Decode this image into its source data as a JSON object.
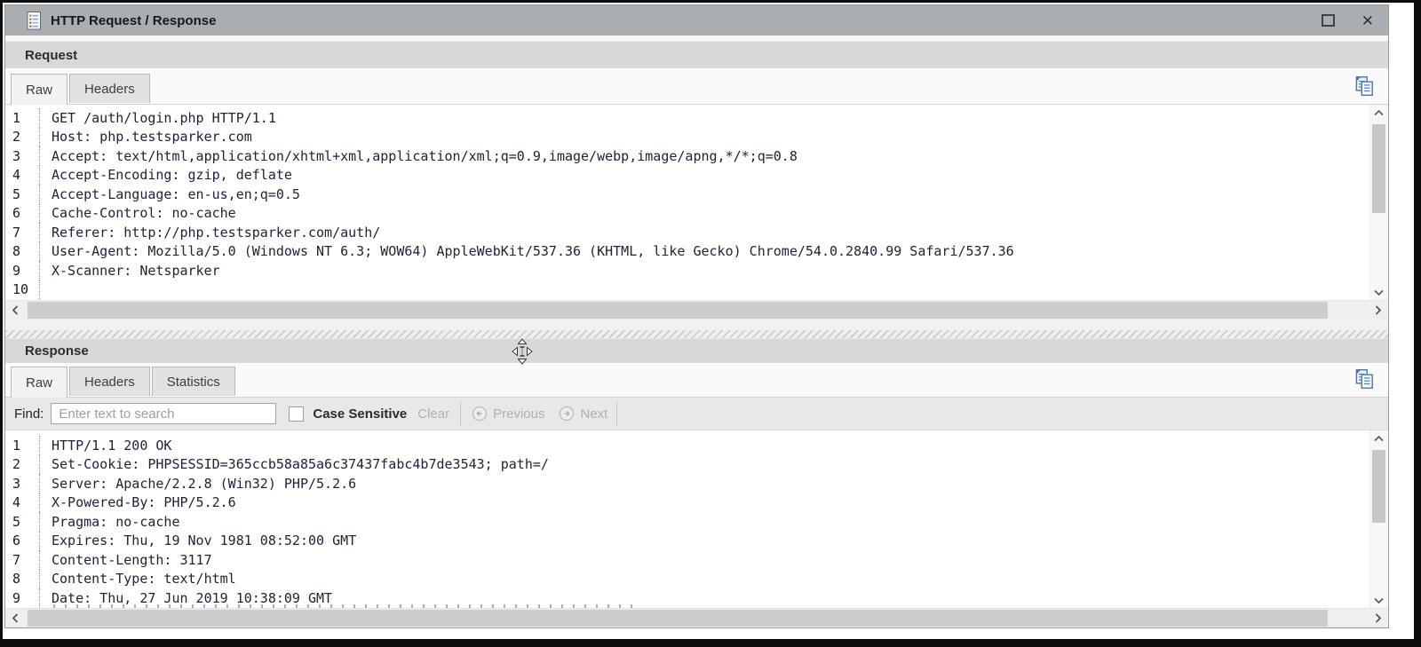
{
  "window": {
    "title": "HTTP Request / Response",
    "controls": {
      "maximize": "maximize",
      "close": "✕"
    }
  },
  "request": {
    "label": "Request",
    "tabs": [
      {
        "label": "Raw",
        "active": true
      },
      {
        "label": "Headers",
        "active": false
      }
    ],
    "lines": [
      {
        "num": "1",
        "text": "GET /auth/login.php HTTP/1.1"
      },
      {
        "num": "2",
        "text": "Host: php.testsparker.com"
      },
      {
        "num": "3",
        "text": "Accept: text/html,application/xhtml+xml,application/xml;q=0.9,image/webp,image/apng,*/*;q=0.8"
      },
      {
        "num": "4",
        "text": "Accept-Encoding: gzip, deflate"
      },
      {
        "num": "5",
        "text": "Accept-Language: en-us,en;q=0.5"
      },
      {
        "num": "6",
        "text": "Cache-Control: no-cache"
      },
      {
        "num": "7",
        "text": "Referer: http://php.testsparker.com/auth/"
      },
      {
        "num": "8",
        "text": "User-Agent: Mozilla/5.0 (Windows NT 6.3; WOW64) AppleWebKit/537.36 (KHTML, like Gecko) Chrome/54.0.2840.99 Safari/537.36"
      },
      {
        "num": "9",
        "text": "X-Scanner: Netsparker"
      },
      {
        "num": "10",
        "text": ""
      }
    ]
  },
  "response": {
    "label": "Response",
    "tabs": [
      {
        "label": "Raw",
        "active": true
      },
      {
        "label": "Headers",
        "active": false
      },
      {
        "label": "Statistics",
        "active": false
      }
    ],
    "find": {
      "label": "Find:",
      "placeholder": "Enter text to search",
      "case_sensitive_label": "Case Sensitive",
      "clear_label": "Clear",
      "previous_label": "Previous",
      "next_label": "Next"
    },
    "lines": [
      {
        "num": "1",
        "text": "HTTP/1.1 200 OK"
      },
      {
        "num": "2",
        "text": "Set-Cookie: PHPSESSID=365ccb58a85a6c37437fabc4b7de3543; path=/"
      },
      {
        "num": "3",
        "text": "Server: Apache/2.2.8 (Win32) PHP/5.2.6"
      },
      {
        "num": "4",
        "text": "X-Powered-By: PHP/5.2.6"
      },
      {
        "num": "5",
        "text": "Pragma: no-cache"
      },
      {
        "num": "6",
        "text": "Expires: Thu, 19 Nov 1981 08:52:00 GMT"
      },
      {
        "num": "7",
        "text": "Content-Length: 3117"
      },
      {
        "num": "8",
        "text": "Content-Type: text/html"
      },
      {
        "num": "9",
        "text": "Date: Thu, 27 Jun 2019 10:38:09 GMT"
      }
    ]
  },
  "colors": {
    "titlebar": "#a9aeb2",
    "section_header": "#d8d8d8",
    "accent_blue": "#4a7ab0",
    "code_text": "#22223a",
    "disabled_text": "#b0b0b0"
  }
}
